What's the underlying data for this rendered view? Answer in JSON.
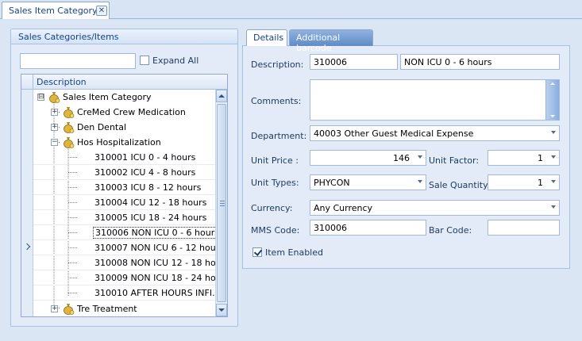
{
  "window": {
    "tab_title": "Sales Item Category",
    "close_glyph": "✕"
  },
  "left_panel": {
    "title": "Sales Categories/Items",
    "search_value": "",
    "expand_all_label": "Expand All",
    "expand_all_checked": false,
    "grid": {
      "column_header": "Description",
      "rows": [
        {
          "label": "Sales Item Category",
          "expander": "⊟",
          "has_icon": true,
          "level": 0
        },
        {
          "label": "CreMed Crew Medication",
          "expander": "+",
          "has_icon": true,
          "level": 1
        },
        {
          "label": "Den Dental",
          "expander": "+",
          "has_icon": true,
          "level": 1
        },
        {
          "label": "Hos Hospitalization",
          "expander": "−",
          "has_icon": true,
          "level": 1
        },
        {
          "label": "310001 ICU 0 - 4 hours",
          "level": 2
        },
        {
          "label": "310002 ICU 4 - 8 hours",
          "level": 2
        },
        {
          "label": "310003 ICU 8 - 12 hours",
          "level": 2
        },
        {
          "label": "310004 ICU 12 - 18 hours",
          "level": 2
        },
        {
          "label": "310005 ICU 18 - 24 hours",
          "level": 2
        },
        {
          "label": "310006 NON ICU  0 - 6 hours",
          "level": 2,
          "selected": true
        },
        {
          "label": "310007 NON ICU  6 - 12 hours",
          "level": 2
        },
        {
          "label": "310008 NON ICU 12 - 18 ho...",
          "level": 2
        },
        {
          "label": "310009 NON ICU 18 - 24 ho...",
          "level": 2
        },
        {
          "label": "310010 AFTER HOURS INFI...",
          "level": 2
        },
        {
          "label": "Tre Treatment",
          "expander": "+",
          "has_icon": true,
          "level": 1
        }
      ]
    }
  },
  "right_panel": {
    "tabs": [
      {
        "label": "Details",
        "active": true
      },
      {
        "label": "Additional barcode",
        "active": false
      }
    ],
    "form": {
      "description_label": "Description:",
      "description_code": "310006",
      "description_text": "NON ICU  0 - 6 hours",
      "comments_label": "Comments:",
      "comments_value": "",
      "department_label": "Department:",
      "department_value": "40003 Other Guest Medical Expense",
      "unit_price_label": "Unit Price :",
      "unit_price_value": "146",
      "unit_factor_label": "Unit Factor:",
      "unit_factor_value": "1",
      "unit_types_label": "Unit Types:",
      "unit_types_value": "PHYCON",
      "sale_quantity_label": "Sale Quantity:",
      "sale_quantity_value": "1",
      "currency_label": "Currency:",
      "currency_value": "Any Currency",
      "mms_code_label": "MMS Code:",
      "mms_code_value": "310006",
      "bar_code_label": "Bar Code:",
      "bar_code_value": "",
      "item_enabled_label": "Item Enabled",
      "item_enabled_checked": true
    }
  },
  "colors": {
    "accent": "#15428b",
    "background": "#d8e4f3",
    "active_tab_bg": "#ffffff",
    "inactive_tab_bg": "#5f8bc6"
  }
}
